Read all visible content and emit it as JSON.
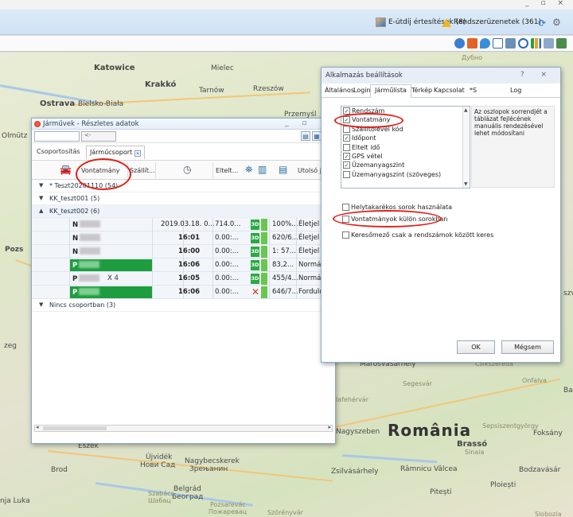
{
  "topbar": {
    "window_controls": "_ ▫ ×",
    "news_label": "E-útdíj értesítések (8)",
    "system_label": "Rendszerüzenetek (361)"
  },
  "map": {
    "labels": {
      "katowice": "Katowice",
      "krakko": "Krakkó",
      "mielec": "Mielec",
      "tarnow": "Tarnów",
      "rzeszow": "Rzeszów",
      "ostrava": "Ostrava",
      "bielsko": "Bielsko-Biała",
      "olmutz": "Olmütz",
      "pozs": "Pozs",
      "przemysl": "Przemyśl",
      "dubno": "Дубно",
      "zeg": "zeg",
      "szv": "szv",
      "marosvasarhely": "Marosvásárhely",
      "csikszereda": "Csíkszereda",
      "segesvar": "Segesvár",
      "onfalva": "Onfalva",
      "gyulafehervar": "Gyulafehérvár",
      "nagyszeben": "Nagyszeben",
      "romania": "România",
      "brasso": "Brassó",
      "sinaia": "Sinaia",
      "sepsi": "Sepsiszentgyörgy",
      "foksany": "Foksány",
      "eszek": "Eszék",
      "ujvidek": "Újvidék",
      "novi_sad": "Нови Сад",
      "nagybecskerek": "Nagybecskerek",
      "zrenjanin": "Зрењанин",
      "belgrad": "Belgrád",
      "beograd": "Београд",
      "szabacs": "Szabács",
      "sabac": "Шабац",
      "zsilvasarhely": "Zsilvásárhely",
      "ramnicu": "Râmnicu Vâlcea",
      "pitesti": "Pitești",
      "ploiesti": "Ploiești",
      "bodzavasar": "Bodzavásár",
      "pozsarevac": "Pozsarevác",
      "pozarevac": "Пожаревац",
      "brod": "Brod",
      "banja_luka": "nja Luka",
      "szorenyvar": "Szörényvár",
      "slobozia": "Slobozia",
      "bal": "Ba"
    }
  },
  "vehicles_window": {
    "title": "Járművek - Részletes adatok",
    "search_back": "<-",
    "tab_grouping": "Csoportosítás",
    "tab_group": "Járműcsoport",
    "columns": {
      "vontatmany": "Vontatmány",
      "szallito": "Szállít...",
      "eltelt": "Eltelt...",
      "utolso": "Utolsó j..."
    },
    "groups": [
      {
        "label": "* Teszt20201110 (54)"
      },
      {
        "label": "KK_teszt001 (5)"
      },
      {
        "label": "KK_teszt002 (6)"
      },
      {
        "label": "Nincs csoportban (3)"
      }
    ],
    "rows": [
      {
        "plate": "N",
        "mid": "",
        "time": "2019.03.18. 0...",
        "elapsed": "714.0...",
        "gps": "3D",
        "level": "100%...",
        "status": "Életjel",
        "green": false
      },
      {
        "plate": "N",
        "mid": "",
        "time": "16:01",
        "elapsed": "0.00:...",
        "gps": "3D",
        "level": "620/6...",
        "status": "Életjel",
        "green": false
      },
      {
        "plate": "N",
        "mid": "",
        "time": "16:00",
        "elapsed": "0.00:...",
        "gps": "3D",
        "level": "1: 57...",
        "status": "Életjel",
        "green": false
      },
      {
        "plate": "P",
        "mid": "",
        "time": "16:06",
        "elapsed": "0.00:...",
        "gps": "3D",
        "level": "83,2...",
        "status": "Normál...",
        "green": true
      },
      {
        "plate": "P",
        "mid": "X 4",
        "time": "16:05",
        "elapsed": "0.00:...",
        "gps": "3D",
        "level": "455/4...",
        "status": "Normál...",
        "green": false
      },
      {
        "plate": "P",
        "mid": "",
        "time": "16:06",
        "elapsed": "0.00:...",
        "gps": "",
        "level": "646/7...",
        "status": "Forduló...",
        "green": true
      }
    ]
  },
  "settings_window": {
    "title": "Alkalmazás beállítások",
    "title_controls": "? ×",
    "tabs": [
      "Általános",
      "Login",
      "Járműlista",
      "Térkép",
      "Kapcsolat",
      "*S",
      "Log"
    ],
    "column_list": [
      {
        "label": "Rendszám",
        "checked": true
      },
      {
        "label": "Vontatmány",
        "checked": true
      },
      {
        "label": "Szállítólevél kód",
        "checked": false
      },
      {
        "label": "Időpont",
        "checked": true
      },
      {
        "label": "Eltelt idő",
        "checked": false
      },
      {
        "label": "GPS vétel",
        "checked": true
      },
      {
        "label": "Üzemanyagszint",
        "checked": true
      },
      {
        "label": "Üzemanyagszint (szöveges)",
        "checked": false
      }
    ],
    "hint": "Az oszlopok sorrendjét a táblázat fejlécének manuális rendezésével lehet módosítani",
    "opt_compact": "Helytakarékos sorok használata",
    "opt_trailers": "Vontatmányok külön sorokban",
    "opt_search": "Keresőmező csak a rendszámok között keres",
    "ok": "OK",
    "cancel": "Mégsem"
  }
}
